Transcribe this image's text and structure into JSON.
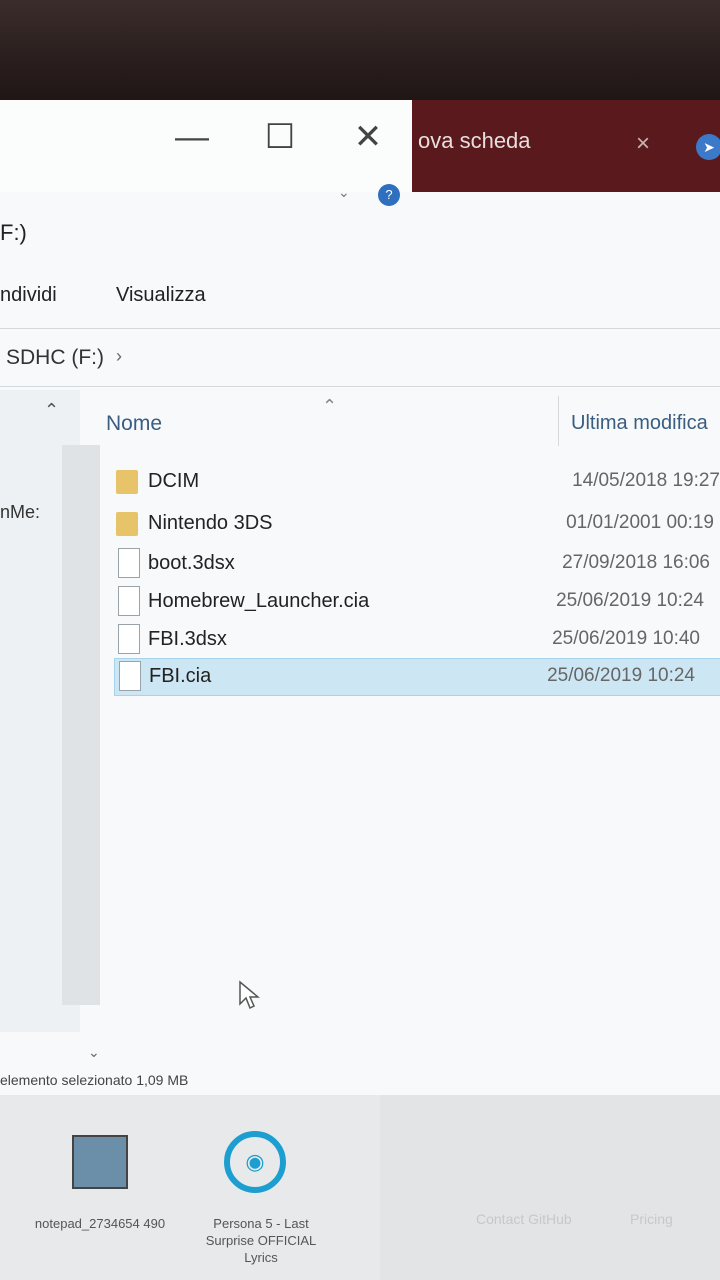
{
  "titlebar": {
    "minimize_icon": "minimize-icon",
    "maximize_icon": "maximize-icon",
    "close_icon": "close-icon",
    "browser_tab_title": "ova scheda",
    "browser_tab_close": "×"
  },
  "window_title": "F:)",
  "menu": {
    "share": "ndividi",
    "view": "Visualizza"
  },
  "breadcrumb": {
    "location": "SDHC (F:)",
    "chevron": "›"
  },
  "nav_pane": {
    "truncated_label": "nMe:"
  },
  "columns": {
    "name": "Nome",
    "modified": "Ultima modifica"
  },
  "files": [
    {
      "name": "DCIM",
      "date": "14/05/2018 19:27",
      "type": "folder"
    },
    {
      "name": "Nintendo 3DS",
      "date": "01/01/2001 00:19",
      "type": "folder"
    },
    {
      "name": "boot.3dsx",
      "date": "27/09/2018 16:06",
      "type": "file"
    },
    {
      "name": "Homebrew_Launcher.cia",
      "date": "25/06/2019 10:24",
      "type": "file"
    },
    {
      "name": "FBI.3dsx",
      "date": "25/06/2019 10:40",
      "type": "file"
    },
    {
      "name": "FBI.cia",
      "date": "25/06/2019 10:24",
      "type": "file",
      "selected": true
    }
  ],
  "status": "elemento selezionato  1,09 MB",
  "desktop": {
    "notepad_label": "notepad_2734654 490",
    "persona_label": "Persona 5 - Last Surprise OFFICIAL Lyrics",
    "faded_1": "Contact GitHub",
    "faded_2": "Pricing"
  }
}
